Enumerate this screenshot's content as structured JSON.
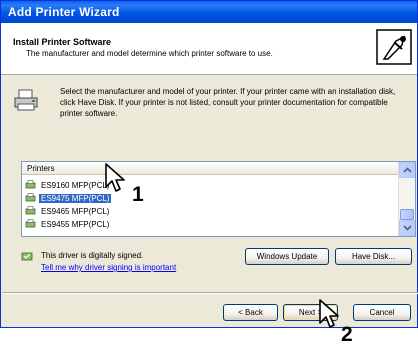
{
  "window": {
    "title": "Add Printer Wizard"
  },
  "header": {
    "title": "Install Printer Software",
    "subtitle": "The manufacturer and model determine which printer software to use."
  },
  "intro": {
    "text": "Select the manufacturer and model of your printer. If your printer came with an installation disk, click Have Disk. If your printer is not listed, consult your printer documentation for compatible printer software."
  },
  "printers": {
    "column_header": "Printers",
    "items": [
      {
        "label": "ES9160 MFP(PCL)",
        "selected": false
      },
      {
        "label": "ES9475 MFP(PCL)",
        "selected": true
      },
      {
        "label": "ES9465 MFP(PCL)",
        "selected": false
      },
      {
        "label": "ES9455 MFP(PCL)",
        "selected": false
      }
    ]
  },
  "signing": {
    "status": "This driver is digitally signed.",
    "link": "Tell me why driver signing is important"
  },
  "buttons": {
    "windows_update": "Windows Update",
    "have_disk": "Have Disk...",
    "back": "< Back",
    "next": "Next >",
    "cancel": "Cancel"
  },
  "callouts": {
    "first": "1",
    "second": "2"
  },
  "colors": {
    "titlebar": "#0055e5",
    "selection": "#316ac5",
    "dialog_bg": "#ece9d8",
    "link": "#0000ff"
  }
}
